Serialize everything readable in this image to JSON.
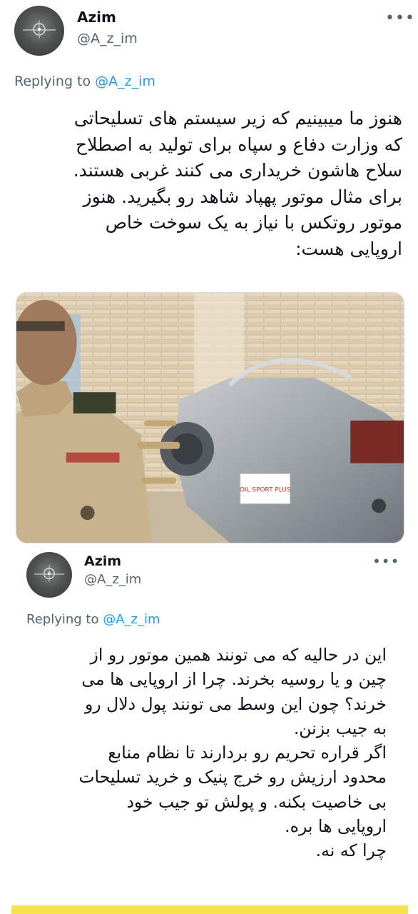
{
  "tweet1": {
    "name": "Azim",
    "handle": "@A_z_im",
    "more": "•••",
    "replying_prefix": "Replying to ",
    "replying_handle": "@A_z_im",
    "text": "هنوز ما میبینیم که زیر سیستم های تسلیحاتی\nکه وزارت دفاع و سپاه برای تولید به اصطلاح\nسلاح هاشون خریداری می کنند غربی هستند.\nبرای مثال موتور پهپاد شاهد رو بگیرید. هنوز\nموتور روتکس با نیاز به یک سوخت خاص\nاروپایی هست:",
    "image_label": "OIL SPORT PLUS"
  },
  "tweet2": {
    "name": "Azim",
    "handle": "@A_z_im",
    "more": "•••",
    "replying_prefix": "Replying to ",
    "replying_handle": "@A_z_im",
    "text": "این در حالیه که می تونند همین موتور رو از\nچین و یا روسیه بخرند. چرا از اروپایی ها می\nخرند؟ چون این وسط می تونند پول دلال رو\nبه جیب بزنن.\nاگر قراره تحریم رو بردارند تا نظام منابع\nمحدود ارزیش رو خرج پنیک و خرید تسلیحات\nبی خاصیت بکنه. و پولش تو جیب خود\nاروپایی ها بره.\nچرا که نه."
  },
  "colors": {
    "link": "#1d9bf0",
    "secondary_text": "#536471",
    "bottom_bar": "#f6e24a"
  }
}
